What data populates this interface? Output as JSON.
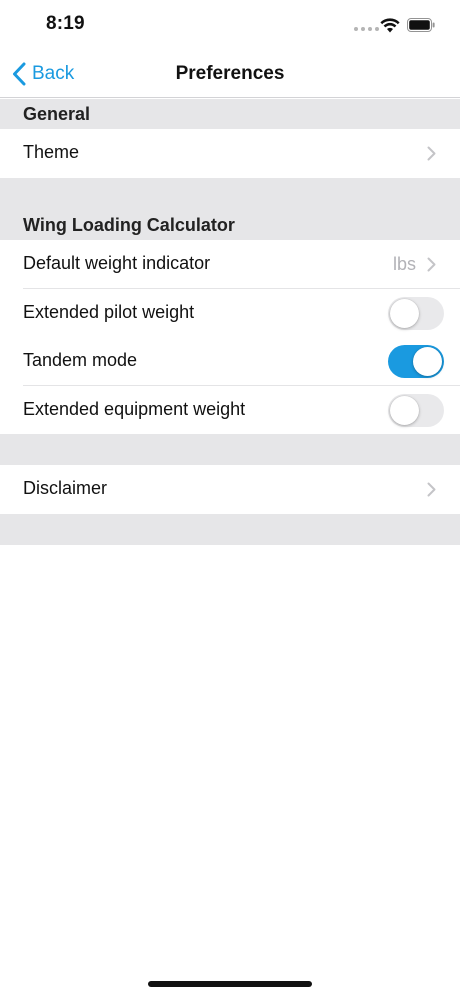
{
  "status_bar": {
    "time": "8:19",
    "icons": [
      "cellular-dots-icon",
      "wifi-icon",
      "battery-icon"
    ]
  },
  "nav": {
    "back_label": "Back",
    "title": "Preferences",
    "back_icon": "chevron-left-icon"
  },
  "colors": {
    "accent": "#1a9ae0",
    "section_background": "#e6e6e8",
    "secondary_text": "#b2b2b7"
  },
  "sections": {
    "general": {
      "header": "General",
      "theme_label": "Theme"
    },
    "wing_loading": {
      "header": "Wing Loading Calculator",
      "default_weight_label": "Default weight indicator",
      "default_weight_value": "lbs",
      "extended_pilot_label": "Extended pilot weight",
      "extended_pilot_on": false,
      "tandem_label": "Tandem mode",
      "tandem_on": true,
      "extended_equipment_label": "Extended equipment weight",
      "extended_equipment_on": false
    },
    "misc": {
      "disclaimer_label": "Disclaimer"
    }
  }
}
